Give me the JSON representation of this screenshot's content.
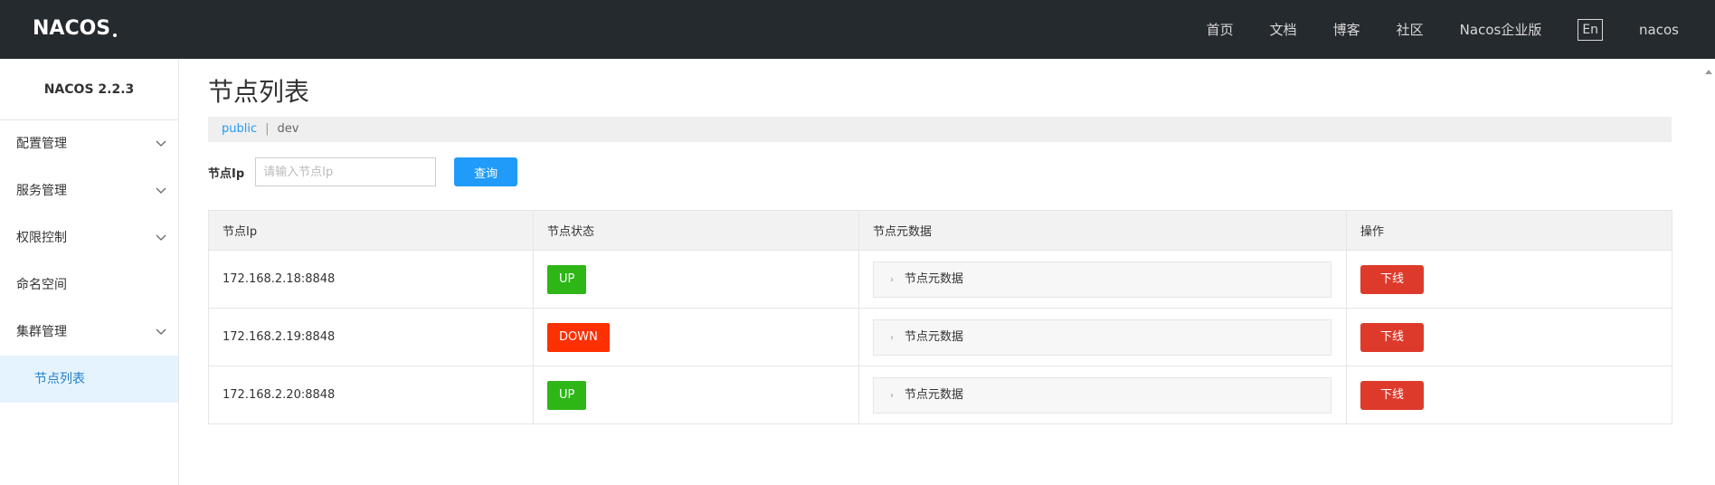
{
  "header": {
    "logo_text": "NACOS",
    "nav": [
      "首页",
      "文档",
      "博客",
      "社区",
      "Nacos企业版"
    ],
    "lang": "En",
    "user": "nacos"
  },
  "sidebar": {
    "version": "NACOS 2.2.3",
    "items": [
      {
        "label": "配置管理",
        "expandable": true
      },
      {
        "label": "服务管理",
        "expandable": true
      },
      {
        "label": "权限控制",
        "expandable": true
      },
      {
        "label": "命名空间",
        "expandable": false
      },
      {
        "label": "集群管理",
        "expandable": true
      }
    ],
    "active_sub": "节点列表"
  },
  "main": {
    "title": "节点列表",
    "namespaces": {
      "active": "public",
      "separator": "|",
      "other": "dev"
    },
    "filter": {
      "label": "节点Ip",
      "placeholder": "请输入节点Ip",
      "query_button": "查询"
    },
    "table": {
      "headers": [
        "节点Ip",
        "节点状态",
        "节点元数据",
        "操作"
      ],
      "rows": [
        {
          "ip": "172.168.2.18:8848",
          "status": "UP",
          "metadata": "节点元数据",
          "action": "下线"
        },
        {
          "ip": "172.168.2.19:8848",
          "status": "DOWN",
          "metadata": "节点元数据",
          "action": "下线"
        },
        {
          "ip": "172.168.2.20:8848",
          "status": "UP",
          "metadata": "节点元数据",
          "action": "下线"
        }
      ]
    }
  },
  "colors": {
    "header_bg": "#252a2f",
    "primary": "#209bfa",
    "status_up": "#2eb617",
    "status_down": "#fc3000",
    "danger": "#de3a2b",
    "active_bg": "#e5f3ff"
  }
}
